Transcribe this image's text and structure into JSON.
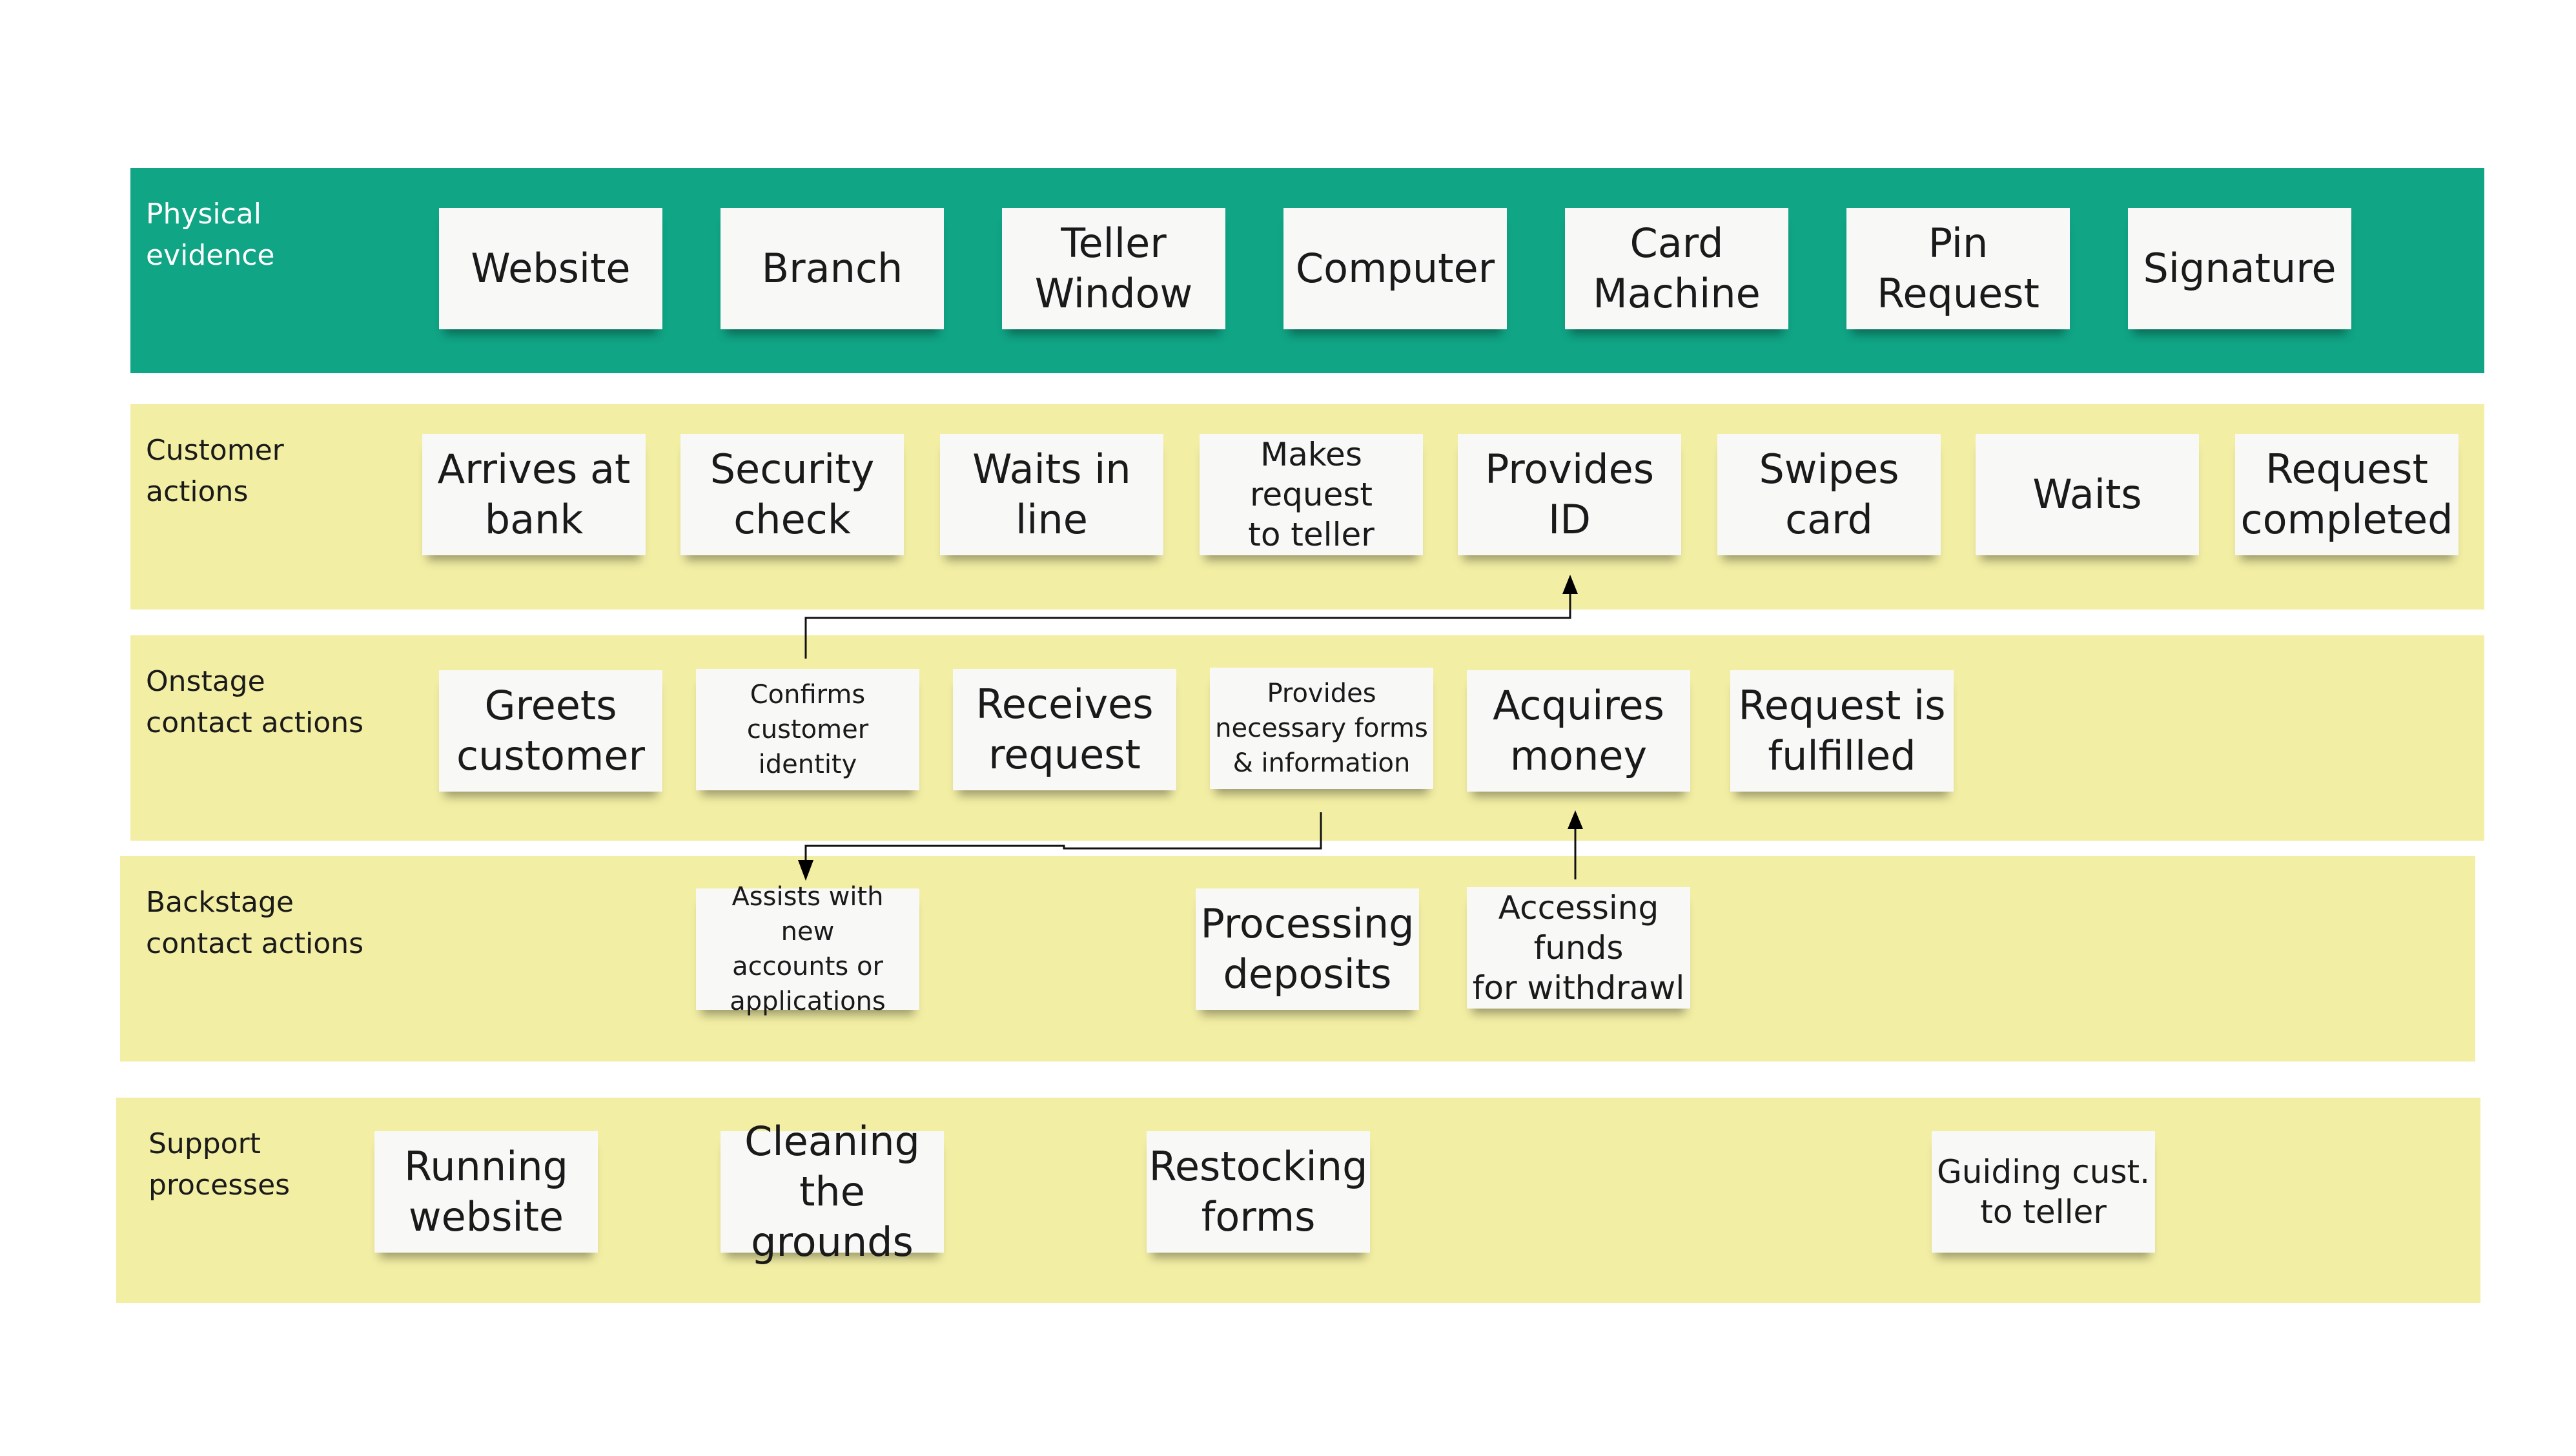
{
  "lanes": {
    "physical": {
      "label": "Physical\nevidence",
      "notes": [
        "Website",
        "Branch",
        "Teller\nWindow",
        "Computer",
        "Card\nMachine",
        "Pin\nRequest",
        "Signature"
      ]
    },
    "customer": {
      "label": "Customer\nactions",
      "notes": [
        "Arrives at\nbank",
        "Security\ncheck",
        "Waits in\nline",
        "Makes request\nto teller",
        "Provides ID",
        "Swipes\ncard",
        "Waits",
        "Request\ncompleted"
      ]
    },
    "onstage": {
      "label": "Onstage\ncontact actions",
      "notes": [
        "Greets\ncustomer",
        "Confirms\ncustomer\nidentity",
        "Receives\nrequest",
        "Provides\nnecessary forms\n& information",
        "Acquires\nmoney",
        "Request is\nfulfilled"
      ]
    },
    "backstage": {
      "label": "Backstage\ncontact actions",
      "notes": [
        "Assists with new\naccounts or\napplications",
        "Processing\ndeposits",
        "Accessing funds\nfor withdrawl"
      ]
    },
    "support": {
      "label": "Support\nprocesses",
      "notes": [
        "Running\nwebsite",
        "Cleaning\nthe grounds",
        "Restocking\nforms",
        "Guiding cust.\nto teller"
      ]
    }
  },
  "connectors": [
    {
      "from": "Confirms customer identity",
      "to": "Provides ID"
    },
    {
      "from": "Provides necessary forms & information",
      "to": "Assists with new accounts or applications"
    },
    {
      "from": "Accessing funds for withdrawl",
      "to": "Acquires money"
    }
  ],
  "colors": {
    "physical_lane": "#10a585",
    "action_lane": "#f2eea4",
    "note": "#f8f8f6"
  }
}
